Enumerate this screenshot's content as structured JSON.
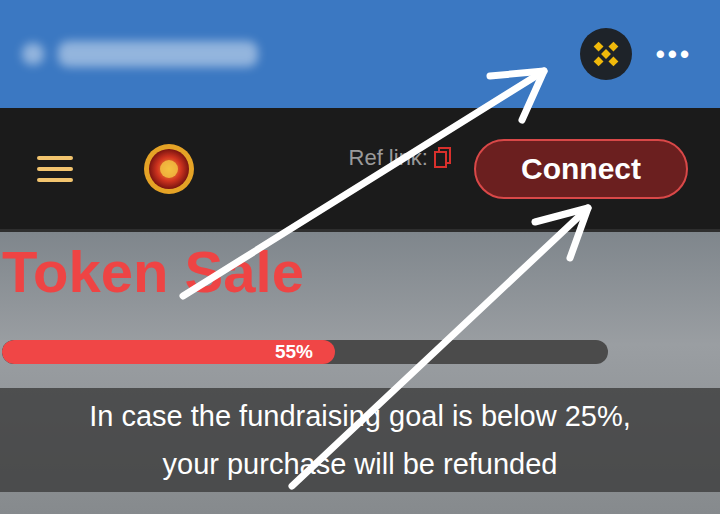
{
  "browser_bar": {
    "menu_glyph": "•••"
  },
  "nav": {
    "ref_link_label": "Ref link:",
    "connect_button": "Connect"
  },
  "token_sale": {
    "title": "Token Sale",
    "progress": {
      "level": 0.55,
      "reading": "55%"
    },
    "notice_lines": [
      "In case the fundraising goal is below 25%,",
      "your purchase will be refunded"
    ]
  }
}
